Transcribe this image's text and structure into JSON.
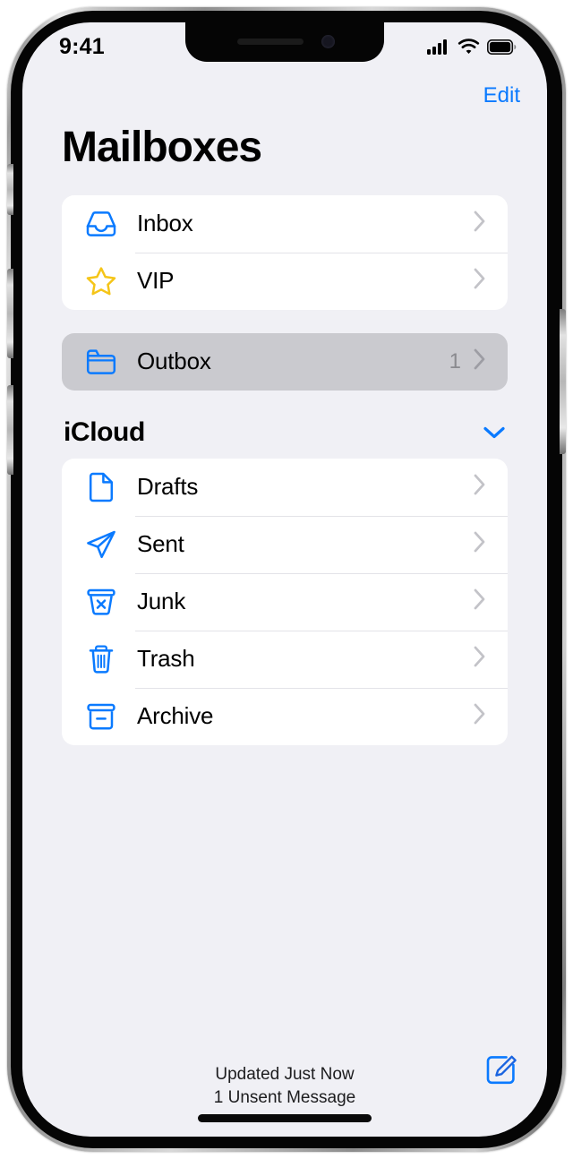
{
  "device": {
    "status_bar": {
      "time": "9:41",
      "cellular_icon": "signal-bars-icon",
      "wifi_icon": "wifi-icon",
      "battery_icon": "battery-full-icon"
    },
    "home_indicator": "home-indicator"
  },
  "nav": {
    "edit_label": "Edit",
    "title": "Mailboxes"
  },
  "colors": {
    "accent_blue": "#0a7aff",
    "star_yellow": "#f5c518",
    "background": "#f0f0f5",
    "card": "#ffffff",
    "highlight": "#cacacf",
    "chevron": "#c3c3c8"
  },
  "primary_group": [
    {
      "label": "Inbox",
      "icon": "inbox-tray-icon",
      "count": "",
      "chevron": "chevron-right-icon"
    },
    {
      "label": "VIP",
      "icon": "star-icon",
      "count": "",
      "chevron": "chevron-right-icon"
    }
  ],
  "outbox_row": {
    "label": "Outbox",
    "icon": "folder-icon",
    "count": "1",
    "chevron": "chevron-right-icon",
    "selected": true
  },
  "icloud_section": {
    "title": "iCloud",
    "toggle_icon": "chevron-down-icon",
    "expanded": true,
    "items": [
      {
        "label": "Drafts",
        "icon": "document-icon",
        "count": "",
        "chevron": "chevron-right-icon"
      },
      {
        "label": "Sent",
        "icon": "paper-plane-icon",
        "count": "",
        "chevron": "chevron-right-icon"
      },
      {
        "label": "Junk",
        "icon": "junk-bin-icon",
        "count": "",
        "chevron": "chevron-right-icon"
      },
      {
        "label": "Trash",
        "icon": "trash-icon",
        "count": "",
        "chevron": "chevron-right-icon"
      },
      {
        "label": "Archive",
        "icon": "archive-box-icon",
        "count": "",
        "chevron": "chevron-right-icon"
      }
    ]
  },
  "footer": {
    "updated_text": "Updated Just Now",
    "unsent_text": "1 Unsent Message",
    "compose_icon": "compose-icon"
  }
}
